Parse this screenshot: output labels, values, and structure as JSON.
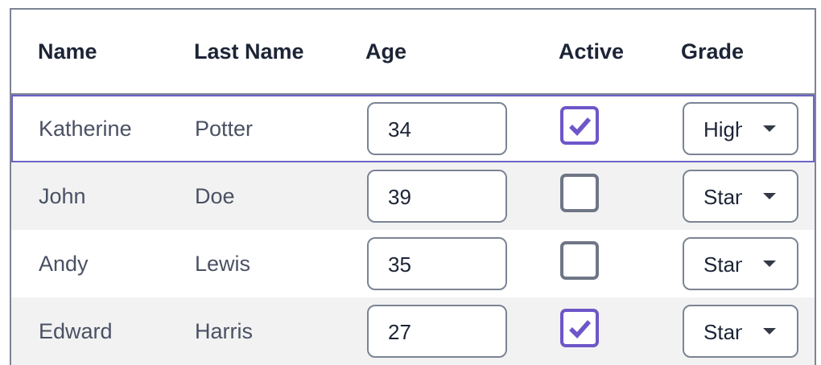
{
  "columns": [
    "Name",
    "Last Name",
    "Age",
    "Active",
    "Grade"
  ],
  "rows": [
    {
      "first_name": "Katherine",
      "last_name": "Potter",
      "age": "34",
      "active": true,
      "grade": "High"
    },
    {
      "first_name": "John",
      "last_name": "Doe",
      "age": "39",
      "active": false,
      "grade": "Standard"
    },
    {
      "first_name": "Andy",
      "last_name": "Lewis",
      "age": "35",
      "active": false,
      "grade": "Standard"
    },
    {
      "first_name": "Edward",
      "last_name": "Harris",
      "age": "27",
      "active": true,
      "grade": "Standard"
    }
  ],
  "selected_row_index": 0,
  "colors": {
    "accent": "#6e56c9",
    "border": "#7b8494",
    "alt_row": "#f2f2f2",
    "header_text": "#1c2436",
    "cell_text": "#4a5163"
  },
  "icons": {
    "checkbox_checked": "checkmark-icon",
    "select_caret": "caret-down-icon"
  }
}
